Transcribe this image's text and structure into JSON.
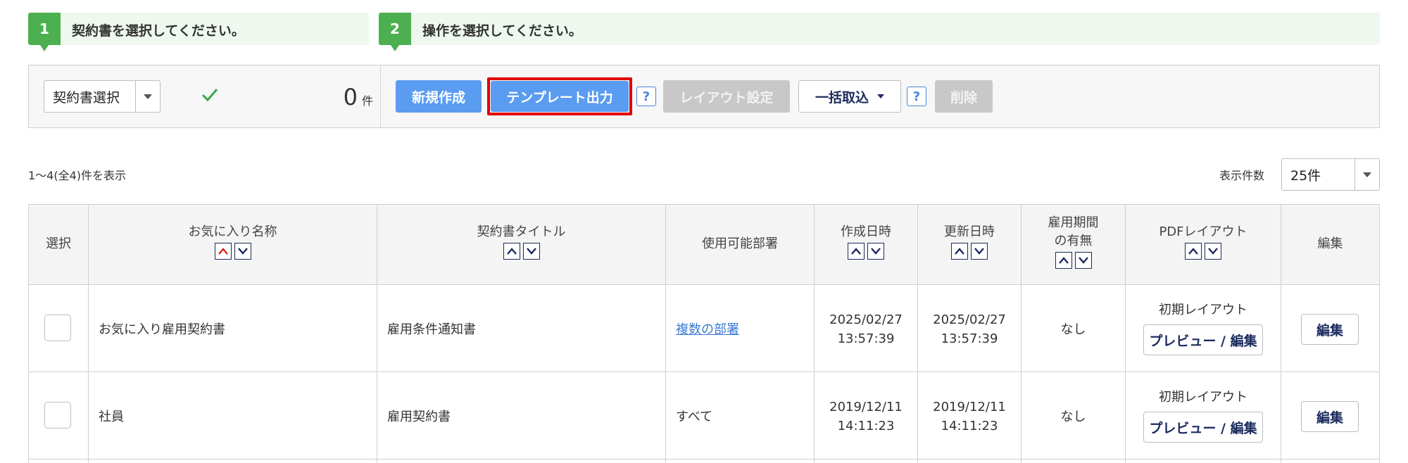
{
  "steps": [
    {
      "num": "1",
      "text": "契約書を選択してください。"
    },
    {
      "num": "2",
      "text": "操作を選択してください。"
    }
  ],
  "selection": {
    "dropdown_label": "契約書選択",
    "count": "0",
    "count_unit": "件"
  },
  "toolbar": {
    "new_label": "新規作成",
    "template_label": "テンプレート出力",
    "layout_label": "レイアウト設定",
    "bulk_label": "一括取込",
    "delete_label": "削除",
    "help_label": "?"
  },
  "list": {
    "range_text": "1～4(全4)件を表示",
    "per_page_label": "表示件数",
    "per_page_value": "25件"
  },
  "table": {
    "headers": {
      "select": "選択",
      "favorite_name": "お気に入り名称",
      "title": "契約書タイトル",
      "departments": "使用可能部署",
      "created": "作成日時",
      "updated": "更新日時",
      "period_1": "雇用期間",
      "period_2": "の有無",
      "pdf_layout": "PDFレイアウト",
      "edit": "編集"
    },
    "rows": [
      {
        "favorite_name": "お気に入り雇用契約書",
        "title": "雇用条件通知書",
        "departments": "複数の部署",
        "created_date": "2025/02/27",
        "created_time": "13:57:39",
        "updated_date": "2025/02/27",
        "updated_time": "13:57:39",
        "period": "なし",
        "layout_name": "初期レイアウト",
        "preview_label": "プレビュー / 編集",
        "edit_label": "編集"
      },
      {
        "favorite_name": "社員",
        "title": "雇用契約書",
        "departments": "すべて",
        "created_date": "2019/12/11",
        "created_time": "14:11:23",
        "updated_date": "2019/12/11",
        "updated_time": "14:11:23",
        "period": "なし",
        "layout_name": "初期レイアウト",
        "preview_label": "プレビュー / 編集",
        "edit_label": "編集"
      }
    ]
  },
  "colors": {
    "step_green": "#4caf50",
    "primary_blue": "#5a9cf0",
    "highlight_red": "#e10000",
    "sort_active_red": "#e02020",
    "navy": "#1c2b5e"
  }
}
